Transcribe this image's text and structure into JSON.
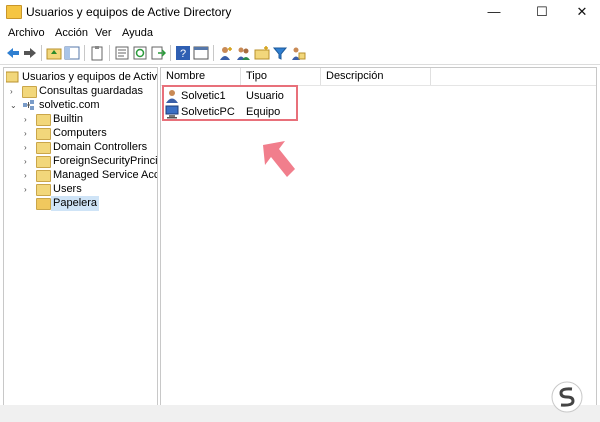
{
  "window": {
    "title": "Usuarios y equipos de Active Directory"
  },
  "window_controls": {
    "minimize": "—",
    "maximize": "☐",
    "close": "✕"
  },
  "menu": [
    "Archivo",
    "Acción",
    "Ver",
    "Ayuda"
  ],
  "tree": {
    "root": "Usuarios y equipos de Active Dir",
    "saved_queries": "Consultas guardadas",
    "domain": "solvetic.com",
    "children": [
      "Builtin",
      "Computers",
      "Domain Controllers",
      "ForeignSecurityPrincipals",
      "Managed Service Accour",
      "Users",
      "Papelera"
    ]
  },
  "list": {
    "columns": [
      "Nombre",
      "Tipo",
      "Descripción"
    ],
    "rows": [
      {
        "name": "Solvetic1",
        "type": "Usuario",
        "icon": "user-icon"
      },
      {
        "name": "SolveticPC",
        "type": "Equipo",
        "icon": "computer-icon"
      }
    ]
  },
  "colors": {
    "highlight": "#e8707a",
    "selection": "#cfe4f7"
  }
}
